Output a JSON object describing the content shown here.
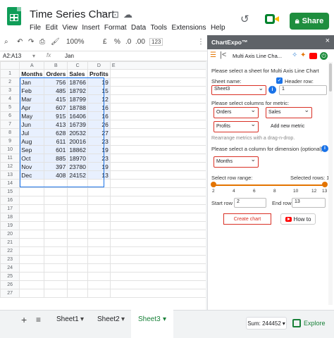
{
  "app": {
    "doc_title": "Time Series Chart",
    "menu": [
      "File",
      "Edit",
      "View",
      "Insert",
      "Format",
      "Data",
      "Tools",
      "Extensions",
      "Help"
    ],
    "share_label": "Share",
    "colors": {
      "brand": "#0f9d58",
      "share": "#1e8e3e",
      "selection": "#1a73e8",
      "accent_orange": "#e37400",
      "highlight_red": "#d93025"
    }
  },
  "toolbar": {
    "zoom": "100%",
    "currency": "£",
    "percent": "%",
    "dec_less": ".0",
    "dec_more": ".00",
    "number_format": "123",
    "icons": [
      "search-icon",
      "undo-icon",
      "redo-icon",
      "print-icon",
      "paint-format-icon",
      "more-icon"
    ]
  },
  "formula_bar": {
    "name_box": "A2:A13",
    "fx": "fx",
    "value": "Jan"
  },
  "grid": {
    "columns": [
      "A",
      "B",
      "C",
      "D",
      "E"
    ],
    "rows": [
      {
        "n": "1",
        "a": "Months",
        "b": "Orders",
        "c": "Sales",
        "d": "Profits"
      },
      {
        "n": "2",
        "a": "Jan",
        "b": "756",
        "c": "18766",
        "d": "19"
      },
      {
        "n": "3",
        "a": "Feb",
        "b": "485",
        "c": "18792",
        "d": "15"
      },
      {
        "n": "4",
        "a": "Mar",
        "b": "415",
        "c": "18799",
        "d": "12"
      },
      {
        "n": "5",
        "a": "Apr",
        "b": "607",
        "c": "18788",
        "d": "16"
      },
      {
        "n": "6",
        "a": "May",
        "b": "915",
        "c": "16406",
        "d": "16"
      },
      {
        "n": "7",
        "a": "Jun",
        "b": "413",
        "c": "16739",
        "d": "26"
      },
      {
        "n": "8",
        "a": "Jul",
        "b": "628",
        "c": "20532",
        "d": "27"
      },
      {
        "n": "9",
        "a": "Aug",
        "b": "611",
        "c": "20016",
        "d": "23"
      },
      {
        "n": "10",
        "a": "Sep",
        "b": "601",
        "c": "18862",
        "d": "19"
      },
      {
        "n": "11",
        "a": "Oct",
        "b": "885",
        "c": "18970",
        "d": "23"
      },
      {
        "n": "12",
        "a": "Nov",
        "b": "397",
        "c": "23780",
        "d": "19"
      },
      {
        "n": "13",
        "a": "Dec",
        "b": "408",
        "c": "24152",
        "d": "13"
      },
      {
        "n": "14"
      },
      {
        "n": "15"
      },
      {
        "n": "16"
      },
      {
        "n": "17"
      },
      {
        "n": "18"
      },
      {
        "n": "19"
      },
      {
        "n": "20"
      },
      {
        "n": "21"
      },
      {
        "n": "22"
      },
      {
        "n": "23"
      },
      {
        "n": "24"
      },
      {
        "n": "25"
      },
      {
        "n": "26"
      },
      {
        "n": "27"
      }
    ]
  },
  "sheets": {
    "add": "+",
    "list": "≡",
    "tabs": [
      "Sheet1",
      "Sheet2",
      "Sheet3"
    ],
    "active": "Sheet3",
    "sum": "Sum: 244452",
    "explore": "Explore"
  },
  "panel": {
    "title": "ChartExpo™",
    "close": "×",
    "chart_name": "Multi Axis Line Cha...",
    "select_sheet_label": "Please select a sheet for Multi Axis Line Chart",
    "sheet_name_label": "Sheet name:",
    "header_row_label": "Header row:",
    "sheet_value": "Sheet3",
    "header_row_value": "1",
    "metric_label": "Please select columns for metric:",
    "metrics": [
      "Orders",
      "Sales",
      "Profits"
    ],
    "add_metric": "Add new metric",
    "rearrange_hint": "Rearrange metrics with a drag-n-drop.",
    "dimension_label": "Please select a column for dimension (optional):",
    "dimension_value": "Months",
    "row_range_label": "Select row range:",
    "selected_rows": "Selected rows: 12",
    "range_ticks": [
      "2",
      "13"
    ],
    "range_mid_ticks": [
      "4",
      "6",
      "8",
      "10",
      "12"
    ],
    "start_row_label": "Start row",
    "start_row_value": "2",
    "end_row_label": "End row",
    "end_row_value": "13",
    "create_chart": "Create chart",
    "how_to": "How to"
  }
}
